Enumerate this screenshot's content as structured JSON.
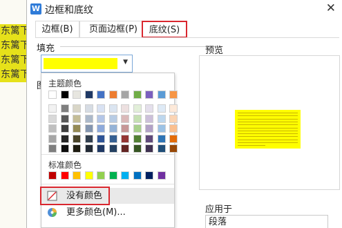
{
  "document": {
    "lines": [
      "东篱下",
      "东篱下",
      "东篱下",
      "东篱下"
    ]
  },
  "dialog": {
    "title": "边框和底纹",
    "close_glyph": "✕",
    "app_icon_label": "W"
  },
  "tabs": [
    {
      "label": "边框(B)",
      "active": false
    },
    {
      "label": "页面边框(P)",
      "active": false
    },
    {
      "label": "底纹(S)",
      "active": true
    }
  ],
  "fill": {
    "label": "填充",
    "selected_color": "#ffff00",
    "dropdown_glyph": "▼"
  },
  "pattern": {
    "label_partial": "图"
  },
  "preview": {
    "label": "预览",
    "fill_color": "#ffff00"
  },
  "apply": {
    "label": "应用于",
    "value": "段落"
  },
  "color_popup": {
    "theme_heading": "主题颜色",
    "theme_top_row": [
      "#ffffff",
      "#000000",
      "#e7e6e0",
      "#1f3864",
      "#4472c4",
      "#ed7d31",
      "#a5a5a5",
      "#70ad47",
      "#7b5fbe",
      "#5b9bd5",
      "#f79646"
    ],
    "theme_shades": [
      [
        "#f2f2f2",
        "#7f7f7f",
        "#d9d6c7",
        "#d6dce4",
        "#d9e2f3",
        "#dbe5f1",
        "#ede0e0",
        "#e2efd9",
        "#e4dfec",
        "#deeaf6",
        "#fde9d9"
      ],
      [
        "#d9d9d9",
        "#595959",
        "#c4bd97",
        "#acb9ca",
        "#b4c6e7",
        "#b8cce4",
        "#dab9b9",
        "#c5e0b3",
        "#ccc0da",
        "#bdd7ee",
        "#fbd4b4"
      ],
      [
        "#bfbfbf",
        "#3f3f3f",
        "#948a54",
        "#8496b0",
        "#8eaadb",
        "#95b3d7",
        "#c69797",
        "#a8d08d",
        "#b2a2c7",
        "#9cc2e5",
        "#fabf8f"
      ],
      [
        "#a6a6a6",
        "#262626",
        "#4a452a",
        "#323f4f",
        "#2f5496",
        "#366092",
        "#943634",
        "#538135",
        "#5f497a",
        "#2e74b5",
        "#e36c09"
      ],
      [
        "#7f7f7f",
        "#0d0d0d",
        "#1d1b10",
        "#222a35",
        "#1f3864",
        "#244061",
        "#632523",
        "#375623",
        "#3f3151",
        "#1f4e79",
        "#974806"
      ]
    ],
    "standard_heading": "标准颜色",
    "standard_row": [
      "#c00000",
      "#ff0000",
      "#ffc000",
      "#ffff00",
      "#92d050",
      "#00b050",
      "#00b0f0",
      "#0070c0",
      "#002060",
      "#7030a0"
    ],
    "no_color_label": "没有颜色",
    "more_colors_label": "更多颜色(M)..."
  },
  "accent_colors": {
    "highlight_red": "#d9262e",
    "selection_yellow": "#ffff00"
  }
}
